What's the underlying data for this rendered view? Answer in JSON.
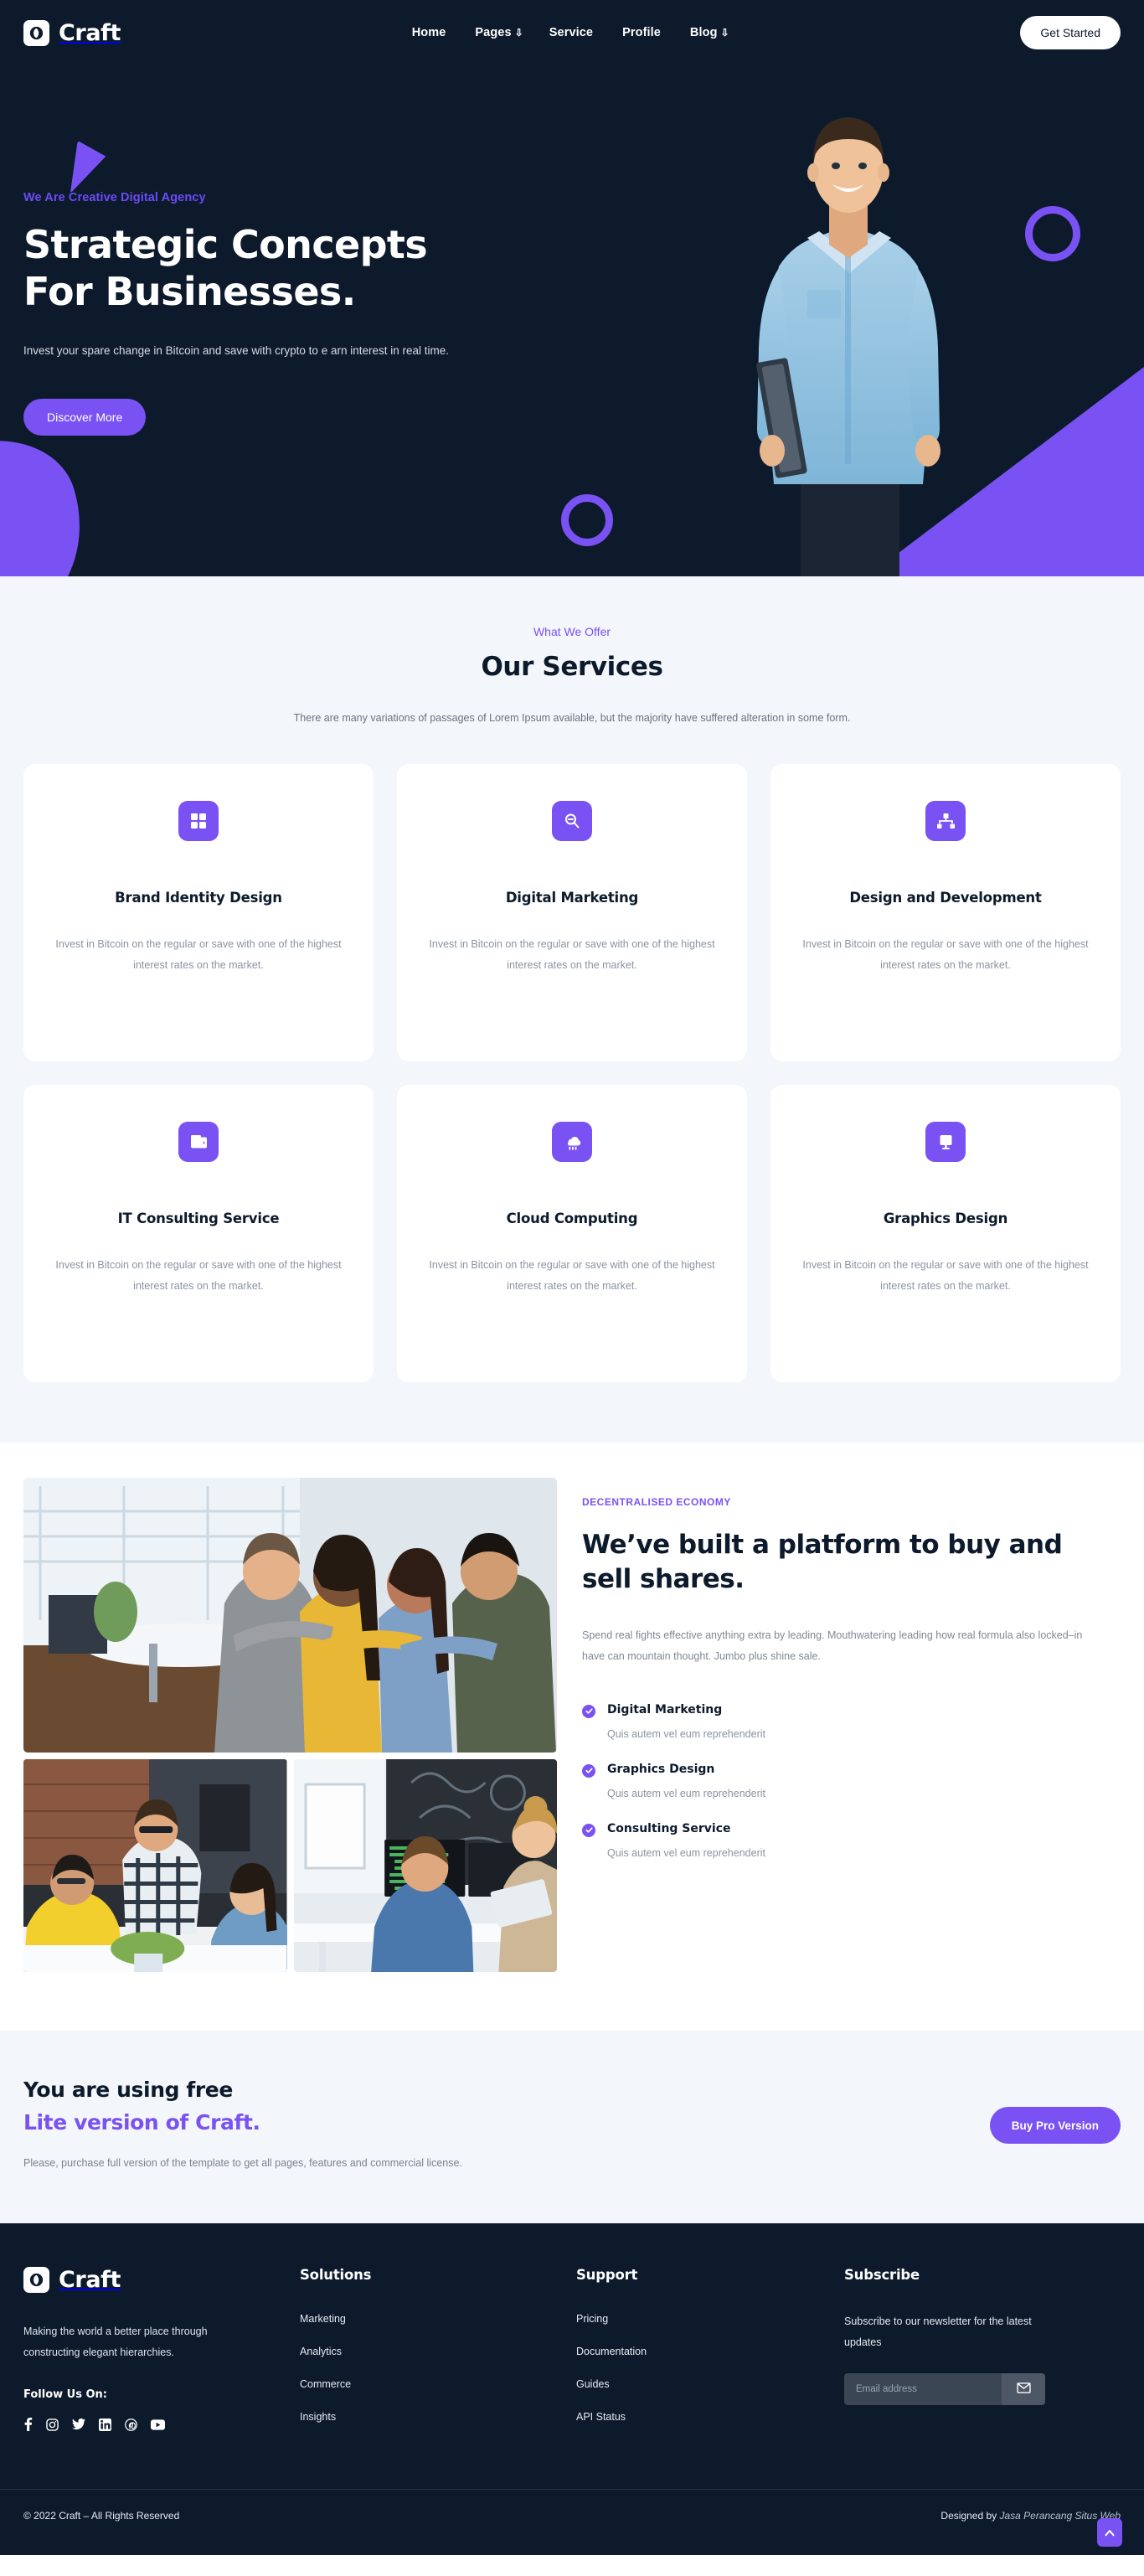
{
  "brand": {
    "name": "Craft",
    "logo_icon": "craft-logo-icon"
  },
  "nav": {
    "links": [
      {
        "label": "Home",
        "caret": ""
      },
      {
        "label": "Pages",
        "caret": "⇩"
      },
      {
        "label": "Service",
        "caret": ""
      },
      {
        "label": "Profile",
        "caret": ""
      },
      {
        "label": "Blog",
        "caret": "⇩"
      }
    ],
    "cta": "Get Started"
  },
  "hero": {
    "eyebrow": "We Are Creative Digital Agency",
    "title": "Strategic Concepts For Businesses.",
    "subtitle": "Invest your spare change in Bitcoin and save with crypto to e arn interest in real time.",
    "button": "Discover More"
  },
  "services": {
    "eyebrow": "What We Offer",
    "title": "Our Services",
    "description": "There are many variations of passages of Lorem Ipsum available, but the majority have suffered alteration in some form.",
    "body": "Invest in Bitcoin on the regular or save with one of the highest interest rates on the market.",
    "cards": [
      {
        "icon": "grid-icon",
        "title": "Brand Identity Design",
        "text": "Invest in Bitcoin on the regular or save with one of the highest interest rates on the market."
      },
      {
        "icon": "search-icon",
        "title": "Digital Marketing",
        "text": "Invest in Bitcoin on the regular or save with one of the highest interest rates on the market."
      },
      {
        "icon": "sitemap-icon",
        "title": "Design and Development",
        "text": "Invest in Bitcoin on the regular or save with one of the highest interest rates on the market."
      },
      {
        "icon": "folder-icon",
        "title": "IT Consulting Service",
        "text": "Invest in Bitcoin on the regular or save with one of the highest interest rates on the market."
      },
      {
        "icon": "cloud-rain-icon",
        "title": "Cloud Computing",
        "text": "Invest in Bitcoin on the regular or save with one of the highest interest rates on the market."
      },
      {
        "icon": "monitor-icon",
        "title": "Graphics Design",
        "text": "Invest in Bitcoin on the regular or save with one of the highest interest rates on the market."
      }
    ]
  },
  "platform": {
    "eyebrow": "DECENTRALISED ECONOMY",
    "title": "We’ve built a platform to buy and sell shares.",
    "text": "Spend real fights effective anything extra by leading. Mouthwatering leading how real formula also locked–in have can mountain thought. Jumbo plus shine sale.",
    "features": [
      {
        "name": "Digital Marketing",
        "desc": "Quis autem vel eum reprehenderit"
      },
      {
        "name": "Graphics Design",
        "desc": "Quis autem vel eum reprehenderit"
      },
      {
        "name": "Consulting Service",
        "desc": "Quis autem vel eum reprehenderit"
      }
    ]
  },
  "lite": {
    "line1": "You are using free",
    "line2": "Lite version of Craft.",
    "paragraph": "Please, purchase full version of the template to get all pages, features and commercial license.",
    "button": "Buy Pro Version"
  },
  "footer": {
    "brand": "Craft",
    "description": "Making the world a better place through constructing elegant hierarchies.",
    "follow_label": "Follow Us On:",
    "socials": [
      "facebook-icon",
      "instagram-icon",
      "twitter-icon",
      "linkedin-icon",
      "pinterest-icon",
      "youtube-icon"
    ],
    "columns": [
      {
        "heading": "Solutions",
        "links": [
          "Marketing",
          "Analytics",
          "Commerce",
          "Insights"
        ]
      },
      {
        "heading": "Support",
        "links": [
          "Pricing",
          "Documentation",
          "Guides",
          "API Status"
        ]
      }
    ],
    "subscribe": {
      "heading": "Subscribe",
      "text": "Subscribe to our newsletter for the latest updates",
      "placeholder": "Email address",
      "value": "",
      "button_icon": "envelope-icon"
    },
    "copyright": "© 2022 Craft – All Rights Reserved",
    "designed_prefix": "Designed by ",
    "designed_by": "Jasa Perancang Situs Web",
    "to_top_icon": "chevron-up-icon"
  },
  "colors": {
    "accent": "#7a52f4",
    "dark": "#0c1a2b",
    "light_bg": "#f3f6fa",
    "muted_text": "#8b93a1"
  }
}
